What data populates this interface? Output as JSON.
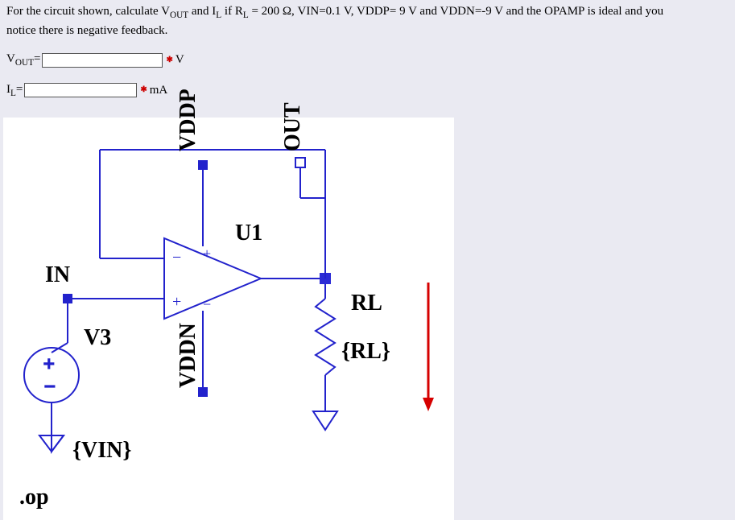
{
  "question": {
    "prompt_line1": "For the circuit shown,   calculate   V",
    "prompt_out_sub": "OUT",
    "prompt_line1b": " and I",
    "prompt_l_sub": "L",
    "prompt_line1c": "  if   R",
    "prompt_line1d": " = 200 Ω, VIN=0.1 V, VDDP= 9 V and VDDN=-9 V and the OPAMP is ideal and you",
    "prompt_line2": "notice there is negative feedback."
  },
  "answers": {
    "vout_label_prefix": "V",
    "vout_label_sub": "OUT",
    "vout_label_eq": "=",
    "vout_value": "",
    "vout_unit": "V",
    "il_label_prefix": "I",
    "il_label_sub": "L",
    "il_label_eq": "=",
    "il_value": "",
    "il_unit": "mA"
  },
  "circuit": {
    "labels": {
      "in": "IN",
      "v3": "V3",
      "vin_param": "{VIN}",
      "op_cmd": ".op",
      "vddp": "VDDP",
      "vddn": "VDDN",
      "u1": "U1",
      "out": "OUT",
      "rl": "RL",
      "rl_param": "{RL}"
    }
  },
  "given": {
    "RL_ohms": 200,
    "VIN_volts": 0.1,
    "VDDP_volts": 9,
    "VDDN_volts": -9,
    "opamp": "ideal",
    "feedback": "negative"
  }
}
